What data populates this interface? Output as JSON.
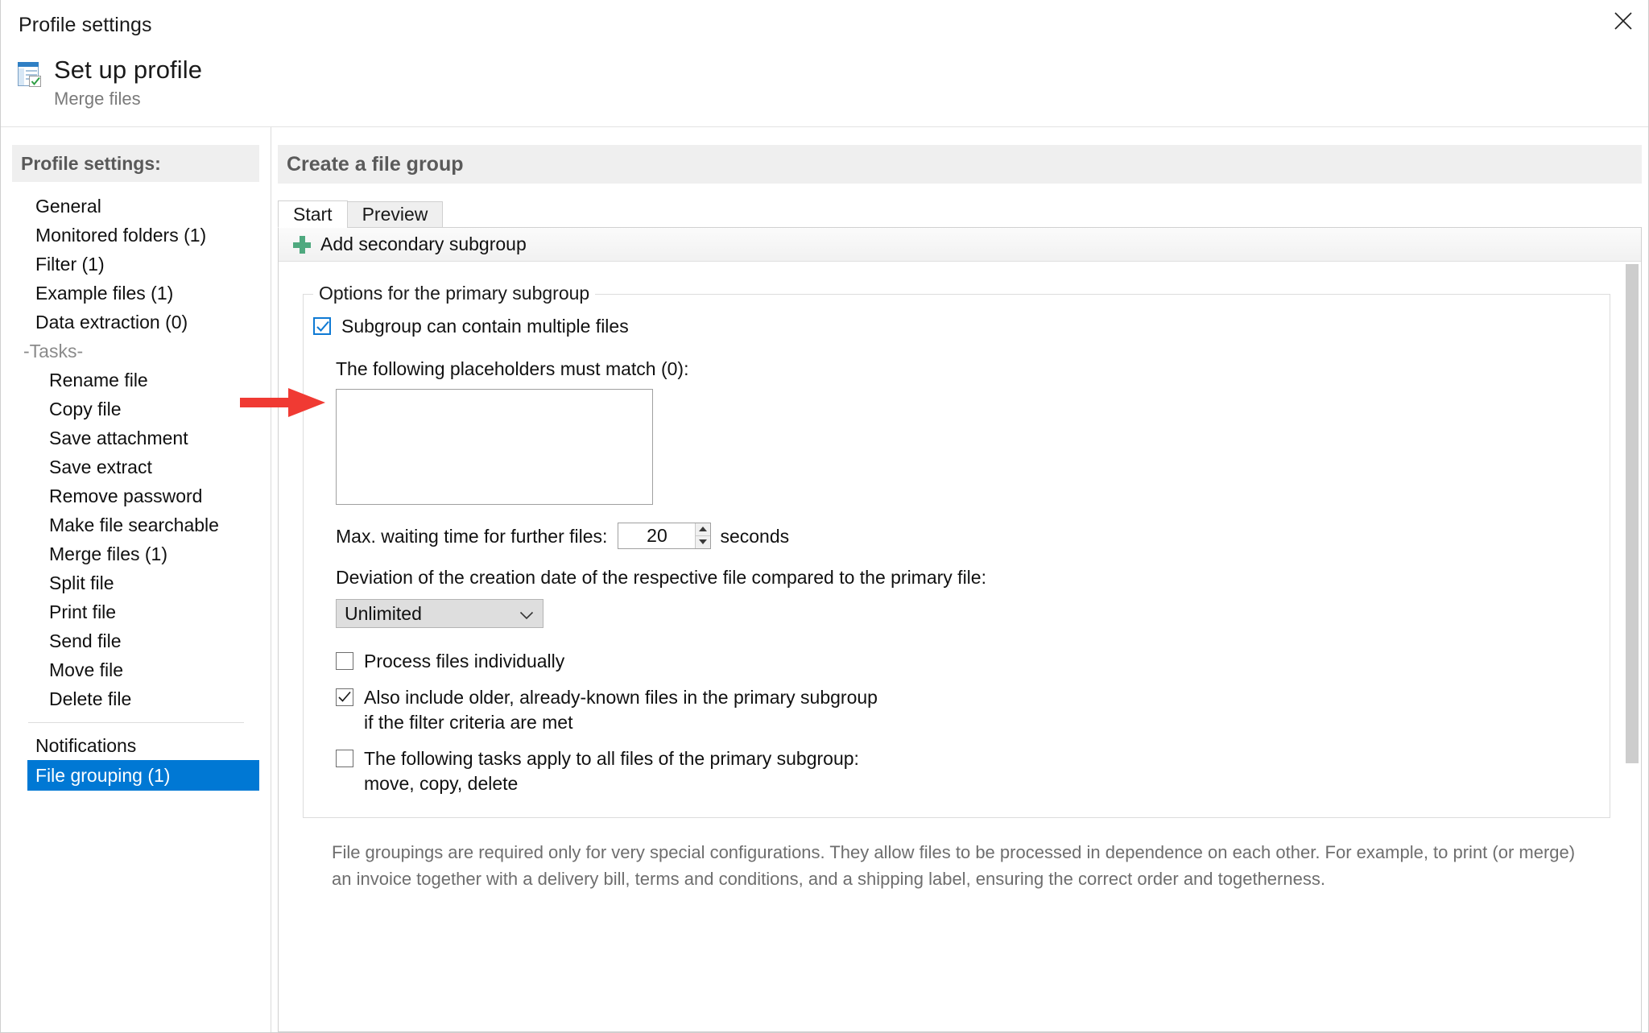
{
  "window": {
    "title": "Profile settings",
    "close_icon": "close-icon"
  },
  "header": {
    "icon": "profile-setup-icon",
    "title": "Set up profile",
    "subtitle": "Merge files"
  },
  "sidebar": {
    "heading": "Profile settings:",
    "items": [
      {
        "label": "General",
        "type": "item",
        "selected": false
      },
      {
        "label": "Monitored folders (1)",
        "type": "item",
        "selected": false
      },
      {
        "label": "Filter (1)",
        "type": "item",
        "selected": false
      },
      {
        "label": "Example files (1)",
        "type": "item",
        "selected": false
      },
      {
        "label": "Data extraction (0)",
        "type": "item",
        "selected": false
      },
      {
        "label": "-Tasks-",
        "type": "section",
        "selected": false
      },
      {
        "label": "Rename file",
        "type": "sub",
        "selected": false
      },
      {
        "label": "Copy file",
        "type": "sub",
        "selected": false
      },
      {
        "label": "Save attachment",
        "type": "sub",
        "selected": false
      },
      {
        "label": "Save extract",
        "type": "sub",
        "selected": false
      },
      {
        "label": "Remove password",
        "type": "sub",
        "selected": false
      },
      {
        "label": "Make file searchable",
        "type": "sub",
        "selected": false
      },
      {
        "label": "Merge files (1)",
        "type": "sub",
        "selected": false
      },
      {
        "label": "Split file",
        "type": "sub",
        "selected": false
      },
      {
        "label": "Print file",
        "type": "sub",
        "selected": false
      },
      {
        "label": "Send file",
        "type": "sub",
        "selected": false
      },
      {
        "label": "Move file",
        "type": "sub",
        "selected": false
      },
      {
        "label": "Delete file",
        "type": "sub",
        "selected": false
      },
      {
        "label": "__SEPARATOR__",
        "type": "separator",
        "selected": false
      },
      {
        "label": "Notifications",
        "type": "item",
        "selected": false
      },
      {
        "label": "File grouping (1)",
        "type": "item",
        "selected": true
      }
    ],
    "selected_color": "#0078d4"
  },
  "main": {
    "title": "Create a file group",
    "tabs": [
      {
        "label": "Start",
        "active": true
      },
      {
        "label": "Preview",
        "active": false
      }
    ],
    "toolbar": {
      "add_secondary_subgroup_label": "Add secondary subgroup",
      "plus_icon": "plus-icon",
      "plus_color": "#4fa97f"
    },
    "groupbox": {
      "legend": "Options for the primary subgroup",
      "multiple_files_checkbox": {
        "label": "Subgroup can contain multiple files",
        "checked": true,
        "accent_color": "#0f7ad4"
      },
      "placeholders_label": "The following placeholders must match (0):",
      "placeholders_value": "",
      "max_wait": {
        "label": "Max. waiting time for further files:",
        "value": "20",
        "unit": "seconds"
      },
      "deviation": {
        "label": "Deviation of the creation date of the respective file compared to the primary file:",
        "selected": "Unlimited"
      },
      "checkboxes": [
        {
          "label": "Process files individually",
          "second_line": "",
          "checked": false
        },
        {
          "label": "Also include older, already-known files in the primary subgroup",
          "second_line": "if the filter criteria are met",
          "checked": true
        },
        {
          "label": "The following tasks apply to all files of the primary subgroup:",
          "second_line": "move, copy, delete",
          "checked": false
        }
      ]
    },
    "footer_info": "File groupings are required only for very special configurations. They allow files to be processed in dependence on each other. For example, to print (or merge) an invoice together with a delivery bill, terms and conditions, and a shipping label, ensuring the correct order and togetherness."
  },
  "annotation": {
    "arrow": "red-arrow-pointer",
    "color": "#f03a33"
  }
}
